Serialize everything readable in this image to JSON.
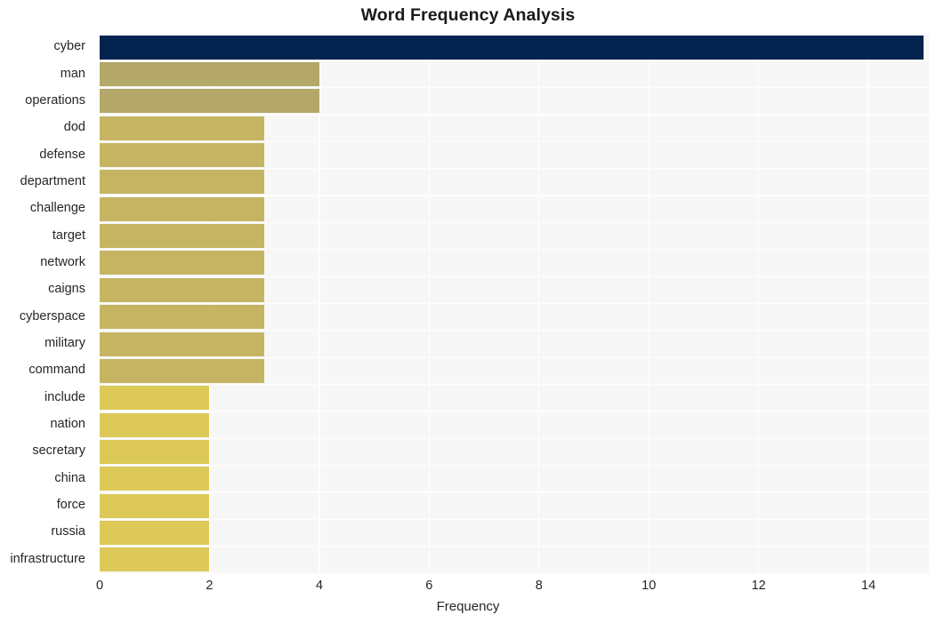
{
  "chart_data": {
    "type": "bar",
    "orientation": "horizontal",
    "title": "Word Frequency Analysis",
    "xlabel": "Frequency",
    "ylabel": "",
    "xlim": [
      0,
      15.1
    ],
    "ylim_categories_order": "descending-by-value",
    "grid": true,
    "legend": "none",
    "xticks": [
      0,
      2,
      4,
      6,
      8,
      10,
      12,
      14
    ],
    "xtick_labels": [
      "0",
      "2",
      "4",
      "6",
      "8",
      "10",
      "12",
      "14"
    ],
    "categories": [
      "cyber",
      "man",
      "operations",
      "dod",
      "defense",
      "department",
      "challenge",
      "target",
      "network",
      "caigns",
      "cyberspace",
      "military",
      "command",
      "include",
      "nation",
      "secretary",
      "china",
      "force",
      "russia",
      "infrastructure"
    ],
    "values": [
      15,
      4,
      4,
      3,
      3,
      3,
      3,
      3,
      3,
      3,
      3,
      3,
      3,
      2,
      2,
      2,
      2,
      2,
      2,
      2
    ],
    "bar_colors": [
      "#04244f",
      "#b3a76a",
      "#b3a76a",
      "#c5b563",
      "#c5b563",
      "#c5b563",
      "#c5b563",
      "#c5b563",
      "#c5b563",
      "#c5b563",
      "#c5b563",
      "#c5b563",
      "#c5b563",
      "#ddc957",
      "#ddc957",
      "#ddc957",
      "#ddc957",
      "#ddc957",
      "#ddc957",
      "#ddc957"
    ],
    "plot_background": "#f7f7f7",
    "gridline_color": "#ffffff",
    "figure_background": "#ffffff",
    "title_color": "#1a1a1a",
    "tick_color": "#262626"
  }
}
